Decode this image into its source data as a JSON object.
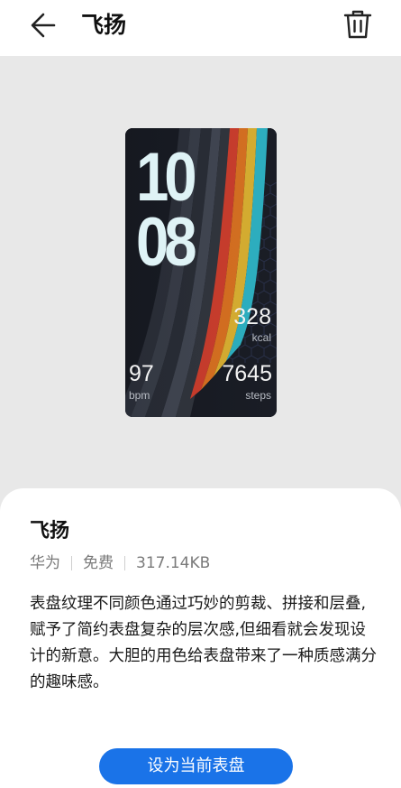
{
  "header": {
    "title": "飞扬",
    "back_icon": "back-arrow-icon",
    "delete_icon": "trash-icon"
  },
  "watchface": {
    "hour": "10",
    "minute": "08",
    "calories": "328",
    "calories_unit": "kcal",
    "heart_rate": "97",
    "heart_rate_unit": "bpm",
    "steps": "7645",
    "steps_unit": "steps",
    "colors": {
      "background": "#171a22",
      "digits": "#dff3f6",
      "stripe_cyan": "#2ec4d6",
      "stripe_yellow": "#f2c230",
      "stripe_orange": "#f07a1e",
      "stripe_red": "#e2402c"
    }
  },
  "details": {
    "name": "飞扬",
    "vendor": "华为",
    "price": "免费",
    "size": "317.14KB",
    "description": "表盘纹理不同颜色通过巧妙的剪裁、拼接和层叠,赋予了简约表盘复杂的层次感,但细看就会发现设计的新意。大胆的用色给表盘带来了一种质感满分的趣味感。"
  },
  "action": {
    "apply_label": "设为当前表盘",
    "accent": "#1a73e8"
  }
}
